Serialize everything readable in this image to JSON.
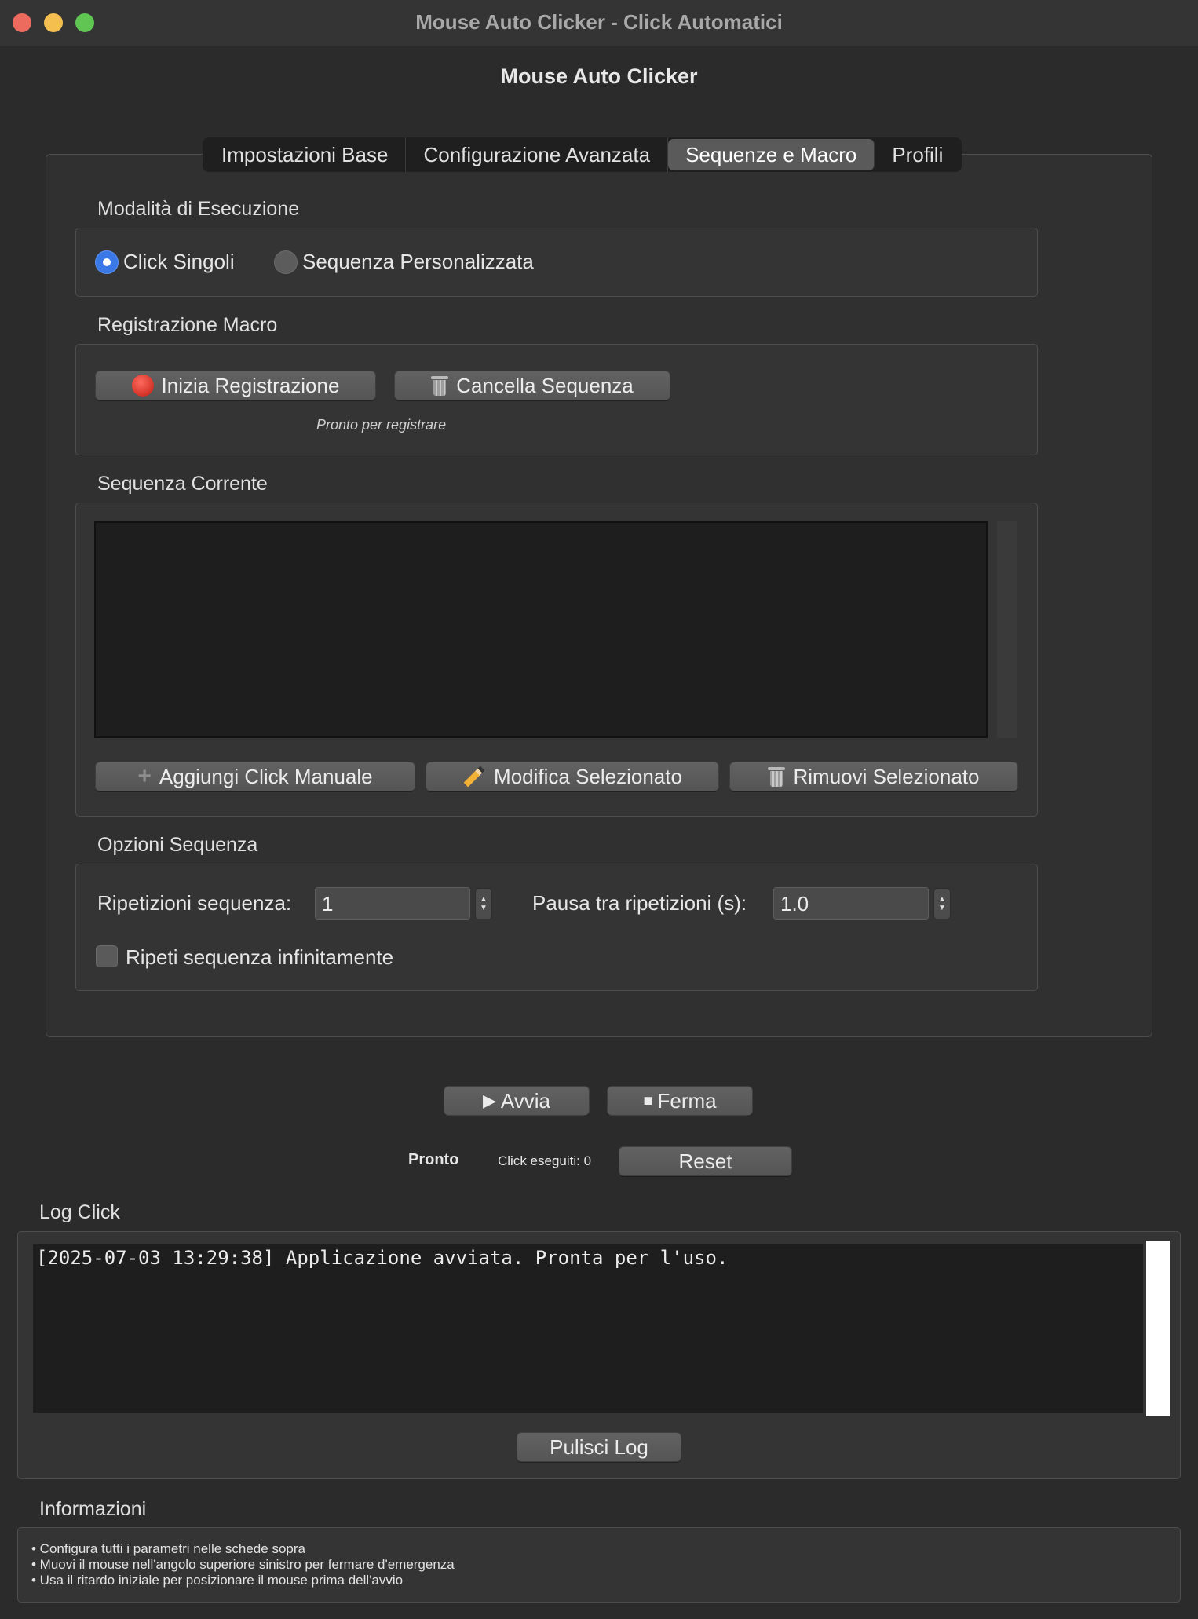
{
  "window": {
    "title": "Mouse Auto Clicker - Click Automatici",
    "heading": "Mouse Auto Clicker"
  },
  "tabs": [
    {
      "label": "Impostazioni Base"
    },
    {
      "label": "Configurazione Avanzata"
    },
    {
      "label": "Sequenze e Macro",
      "active": true
    },
    {
      "label": "Profili"
    }
  ],
  "mode": {
    "label": "Modalità di Esecuzione",
    "options": [
      {
        "label": "Click Singoli",
        "selected": true
      },
      {
        "label": "Sequenza Personalizzata",
        "selected": false
      }
    ]
  },
  "macro": {
    "label": "Registrazione Macro",
    "record_button": "Inizia Registrazione",
    "clear_button": "Cancella Sequenza",
    "status": "Pronto per registrare"
  },
  "sequence": {
    "label": "Sequenza Corrente",
    "items": [],
    "add_button": "Aggiungi Click Manuale",
    "edit_button": "Modifica Selezionato",
    "remove_button": "Rimuovi Selezionato"
  },
  "options": {
    "label": "Opzioni Sequenza",
    "repeat_label": "Ripetizioni sequenza:",
    "repeat_value": "1",
    "pause_label": "Pausa tra ripetizioni (s):",
    "pause_value": "1.0",
    "infinite_label": "Ripeti sequenza infinitamente",
    "infinite_checked": false
  },
  "controls": {
    "start_button": "Avvia",
    "stop_button": "Ferma",
    "status": "Pronto",
    "click_count": "Click eseguiti: 0",
    "reset_button": "Reset"
  },
  "log": {
    "label": "Log Click",
    "lines": [
      "[2025-07-03 13:29:38] Applicazione avviata. Pronta per l'uso."
    ],
    "clear_button": "Pulisci Log"
  },
  "info": {
    "label": "Informazioni",
    "lines": [
      "• Configura tutti i parametri nelle schede sopra",
      "• Muovi il mouse nell'angolo superiore sinistro per fermare d'emergenza",
      "• Usa il ritardo iniziale per posizionare il mouse prima dell'avvio"
    ]
  },
  "colors": {
    "accent": "#3b78e7",
    "window_bg": "#2b2b2b",
    "record_red": "#e0392b"
  }
}
